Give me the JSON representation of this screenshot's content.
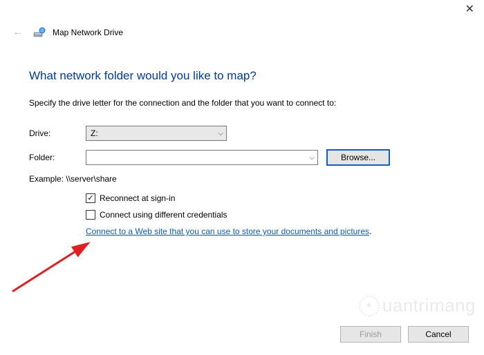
{
  "window": {
    "title": "Map Network Drive"
  },
  "heading": "What network folder would you like to map?",
  "instruction": "Specify the drive letter for the connection and the folder that you want to connect to:",
  "form": {
    "drive_label": "Drive:",
    "drive_value": "Z:",
    "folder_label": "Folder:",
    "folder_value": "",
    "browse_label": "Browse...",
    "example": "Example: \\\\server\\share",
    "reconnect_label": "Reconnect at sign-in",
    "reconnect_checked": true,
    "diffcred_label": "Connect using different credentials",
    "diffcred_checked": false,
    "link_text": "Connect to a Web site that you can use to store your documents and pictures"
  },
  "footer": {
    "finish": "Finish",
    "cancel": "Cancel"
  },
  "watermark": "uantrimang"
}
